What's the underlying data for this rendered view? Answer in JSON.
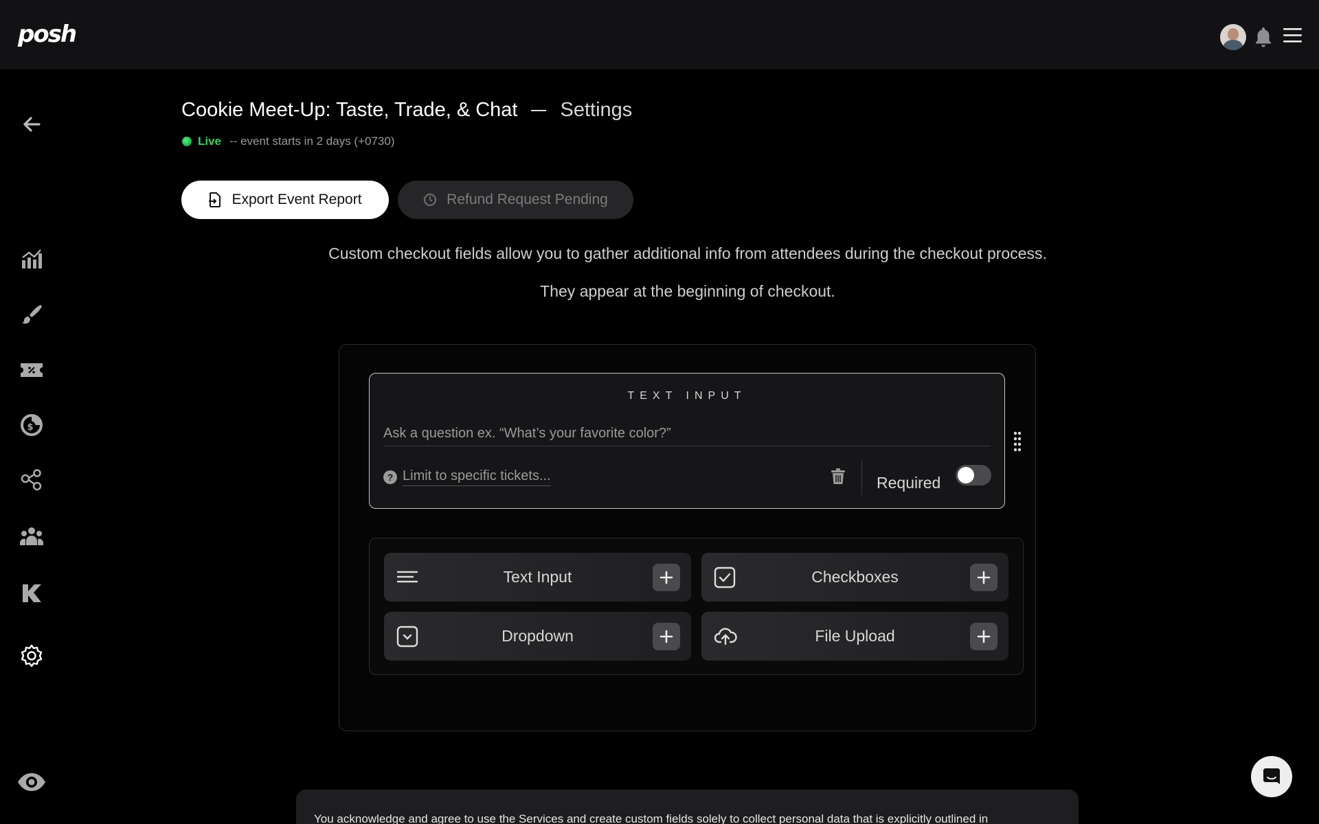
{
  "app": {
    "logo_text": "posh"
  },
  "topbar": {
    "avatar_alt": "user avatar",
    "icons": [
      "bell-icon",
      "hamburger-menu-icon"
    ]
  },
  "sidebar": {
    "items": [
      {
        "name": "back",
        "icon": "arrow-left-icon"
      },
      {
        "name": "analytics",
        "icon": "bar-chart-icon"
      },
      {
        "name": "design",
        "icon": "paintbrush-icon"
      },
      {
        "name": "promo-codes",
        "icon": "ticket-percent-icon"
      },
      {
        "name": "finance",
        "icon": "dollar-chart-icon"
      },
      {
        "name": "team",
        "icon": "people-network-icon"
      },
      {
        "name": "attendees",
        "icon": "group-icon"
      },
      {
        "name": "kickback",
        "icon": "k-icon"
      },
      {
        "name": "settings",
        "icon": "gear-icon"
      },
      {
        "name": "preview",
        "icon": "eye-icon"
      }
    ]
  },
  "header": {
    "event_title": "Cookie Meet-Up: Taste, Trade, & Chat",
    "page_title": "Settings",
    "status_label": "Live",
    "status_text": "-- event starts in 2 days (+0730)"
  },
  "actions": {
    "export_label": "Export Event Report",
    "refund_label": "Refund Request Pending"
  },
  "description": {
    "line1": "Custom checkout fields allow you to gather additional info from attendees during the checkout process.",
    "line2": "They appear at the beginning of checkout."
  },
  "field_card": {
    "type_label": "TEXT INPUT",
    "question_placeholder": "Ask a question ex. “What’s your favorite color?”",
    "limit_label": "Limit to specific tickets...",
    "required_label": "Required",
    "required_on": false
  },
  "add_fields": [
    {
      "label": "Text Input",
      "icon": "text-lines-icon"
    },
    {
      "label": "Checkboxes",
      "icon": "checkbox-icon"
    },
    {
      "label": "Dropdown",
      "icon": "dropdown-icon"
    },
    {
      "label": "File Upload",
      "icon": "cloud-upload-icon"
    }
  ],
  "bottom": {
    "notice_text": "You acknowledge and agree to use the Services and create custom fields solely to collect personal data that is explicitly outlined in"
  },
  "colors": {
    "live": "#33d45e",
    "background": "#000000",
    "topbar": "#121214"
  }
}
